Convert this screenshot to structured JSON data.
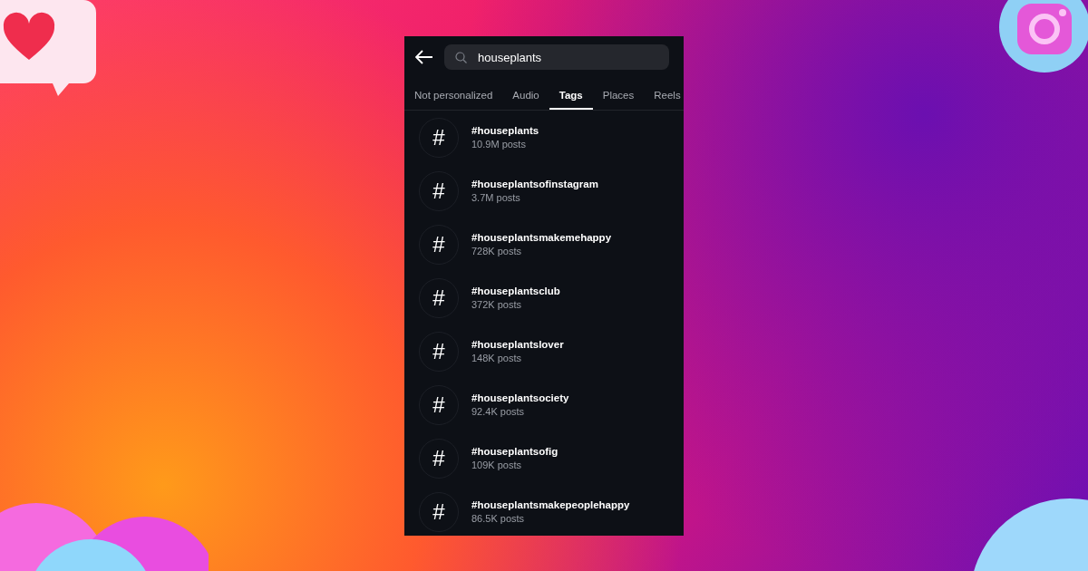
{
  "search": {
    "query": "houseplants"
  },
  "tabs": [
    {
      "label": "Not personalized",
      "selected": false
    },
    {
      "label": "Audio",
      "selected": false
    },
    {
      "label": "Tags",
      "selected": true
    },
    {
      "label": "Places",
      "selected": false
    },
    {
      "label": "Reels",
      "selected": false
    }
  ],
  "results": [
    {
      "symbol": "#",
      "name": "#houseplants",
      "posts": "10.9M posts"
    },
    {
      "symbol": "#",
      "name": "#houseplantsofinstagram",
      "posts": "3.7M posts"
    },
    {
      "symbol": "#",
      "name": "#houseplantsmakemehappy",
      "posts": "728K posts"
    },
    {
      "symbol": "#",
      "name": "#houseplantsclub",
      "posts": "372K posts"
    },
    {
      "symbol": "#",
      "name": "#houseplantslover",
      "posts": "148K posts"
    },
    {
      "symbol": "#",
      "name": "#houseplantsociety",
      "posts": "92.4K posts"
    },
    {
      "symbol": "#",
      "name": "#houseplantsofig",
      "posts": "109K posts"
    },
    {
      "symbol": "#",
      "name": "#houseplantsmakepeoplehappy",
      "posts": "86.5K posts"
    }
  ]
}
